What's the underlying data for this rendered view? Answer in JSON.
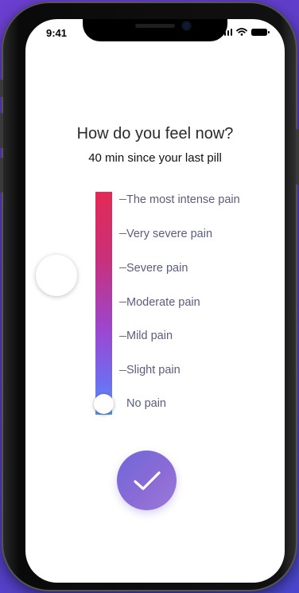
{
  "status": {
    "time": "9:41"
  },
  "screen": {
    "title": "How do you feel now?",
    "subtitle": "40 min since your last pill"
  },
  "pain_scale": {
    "levels": [
      "The most intense pain",
      "Very severe pain",
      "Severe pain",
      "Moderate pain",
      "Mild pain",
      "Slight pain",
      "No pain"
    ],
    "selected_index": 6,
    "gradient_colors": [
      "#e22a55",
      "#c8307a",
      "#9b47cf",
      "#6f6cf0",
      "#5a95ee"
    ]
  },
  "actions": {
    "confirm_icon": "checkmark-icon"
  }
}
